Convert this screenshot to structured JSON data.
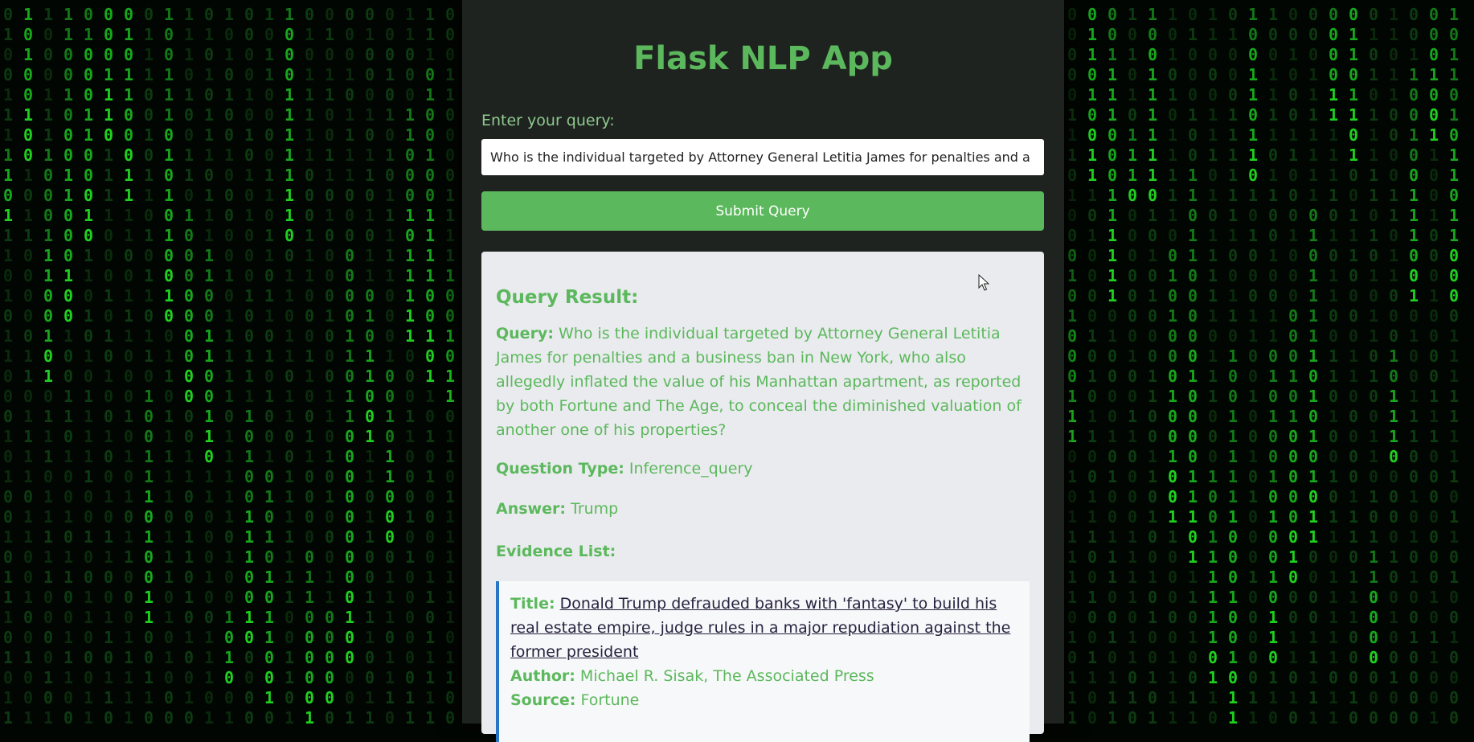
{
  "app": {
    "title": "Flask NLP App"
  },
  "form": {
    "label": "Enter your query:",
    "input_value": "Who is the individual targeted by Attorney General Letitia James for penalties and a business ban in New York, who also allegedly inflated the value of his Manhattan apartment, as reported by both Fortune and The Age, to conceal the diminished valuation of another one of his properties?",
    "submit_label": "Submit Query"
  },
  "result": {
    "heading": "Query Result:",
    "query_label": "Query:",
    "query_text": "Who is the individual targeted by Attorney General Letitia James for penalties and a business ban in New York, who also allegedly inflated the value of his Manhattan apartment, as reported by both Fortune and The Age, to conceal the diminished valuation of another one of his properties?",
    "type_label": "Question Type:",
    "type_value": "Inference_query",
    "answer_label": "Answer:",
    "answer_value": "Trump",
    "evidence_heading": "Evidence List:",
    "evidence": [
      {
        "title_label": "Title:",
        "title": "Donald Trump defrauded banks with 'fantasy' to build his real estate empire, judge rules in a major repudiation against the former president",
        "author_label": "Author:",
        "author": "Michael R. Sisak, The Associated Press",
        "source_label": "Source:",
        "source": "Fortune"
      }
    ]
  },
  "theme": {
    "accent": "#5cb85c",
    "panel_bg": "#202621",
    "card_bg": "#e9ebee",
    "evidence_border": "#2a76c6",
    "link_color": "#27223f",
    "matrix_green": "#1fd11f"
  },
  "icons": {
    "cursor": "arrow-cursor-icon"
  }
}
